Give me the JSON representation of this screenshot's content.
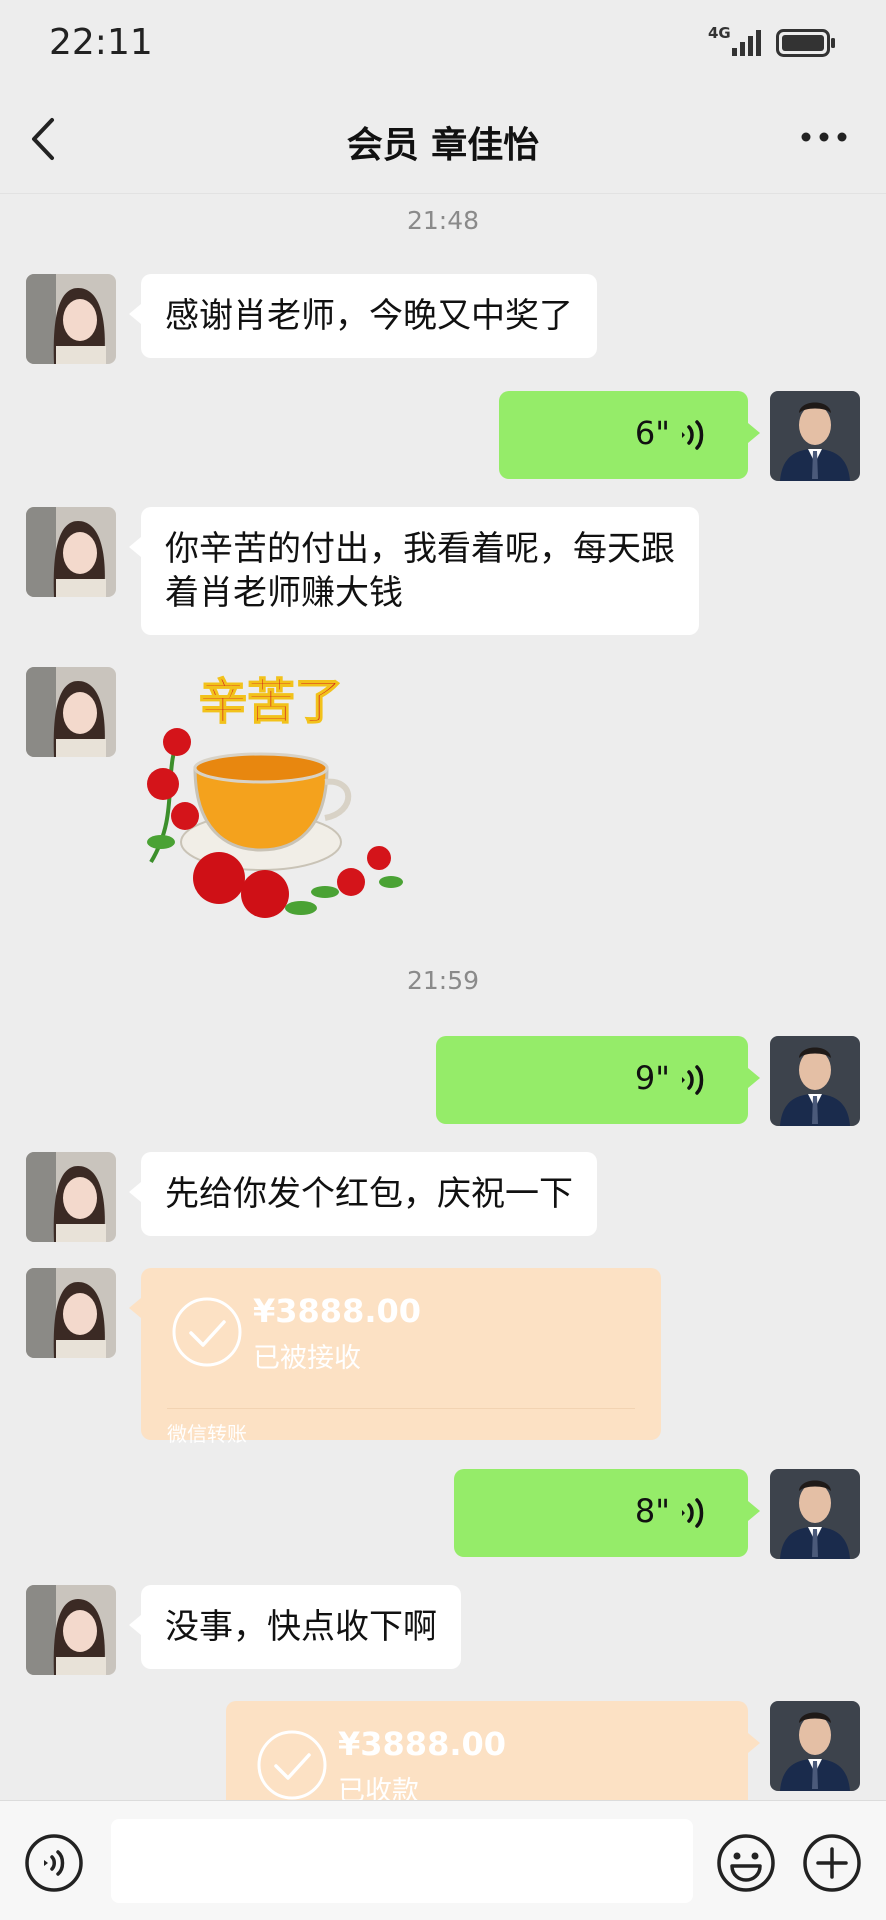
{
  "status_bar": {
    "time": "22:11",
    "network": "4G"
  },
  "nav": {
    "title": "会员 章佳怡"
  },
  "timestamps": [
    "21:48",
    "21:59"
  ],
  "messages": {
    "m1": "感谢肖老师，今晚又中奖了",
    "v1": "6\"",
    "m2_line1": "你辛苦的付出，我看着呢，每天跟",
    "m2_line2": "着肖老师赚大钱",
    "sticker_text": "辛苦了",
    "v2": "9\"",
    "m3": "先给你发个红包，庆祝一下",
    "t1_amount": "¥3888.00",
    "t1_state": "已被接收",
    "t1_source": "微信转账",
    "v3": "8\"",
    "m4": "没事，快点收下啊",
    "t2_amount": "¥3888.00",
    "t2_state": "已收款"
  },
  "input": {
    "value": ""
  },
  "colors": {
    "outgoing": "#95ec69",
    "incoming": "#ffffff",
    "transfer": "#fce1c4",
    "background": "#ededed"
  }
}
